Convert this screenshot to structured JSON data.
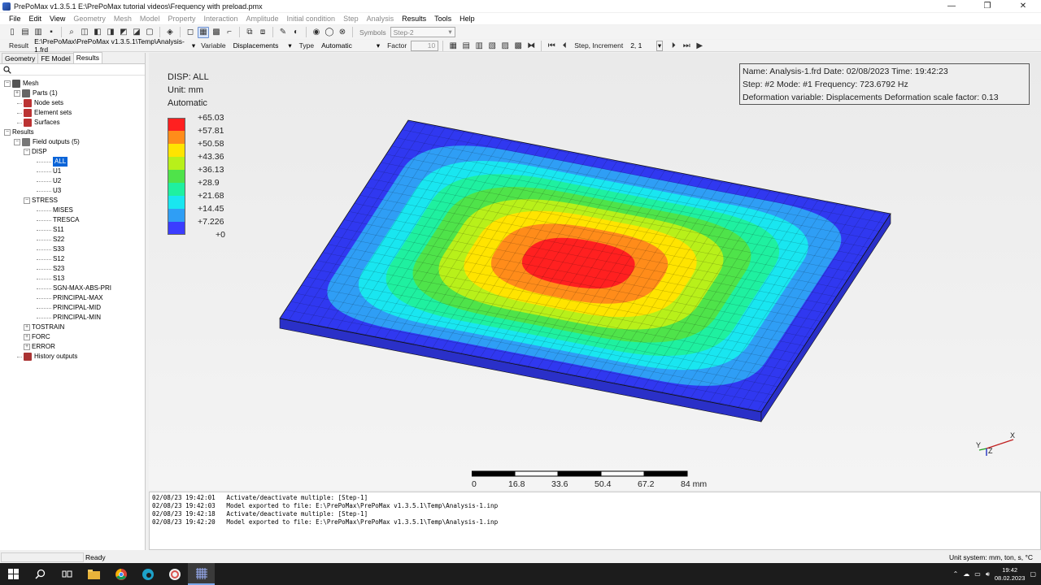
{
  "window": {
    "title": "PrePoMax v1.3.5.1   E:\\PrePoMax tutorial videos\\Frequency with preload.pmx",
    "minimize": "—",
    "maximize": "❐",
    "close": "✕"
  },
  "menu": [
    {
      "label": "File",
      "enabled": true
    },
    {
      "label": "Edit",
      "enabled": true
    },
    {
      "label": "View",
      "enabled": true
    },
    {
      "label": "Geometry",
      "enabled": false
    },
    {
      "label": "Mesh",
      "enabled": false
    },
    {
      "label": "Model",
      "enabled": false
    },
    {
      "label": "Property",
      "enabled": false
    },
    {
      "label": "Interaction",
      "enabled": false
    },
    {
      "label": "Amplitude",
      "enabled": false
    },
    {
      "label": "Initial condition",
      "enabled": false
    },
    {
      "label": "Step",
      "enabled": false
    },
    {
      "label": "Analysis",
      "enabled": false
    },
    {
      "label": "Results",
      "enabled": true
    },
    {
      "label": "Tools",
      "enabled": true
    },
    {
      "label": "Help",
      "enabled": true
    }
  ],
  "toolbar1": {
    "symbols_label": "Symbols",
    "symbols_value": "Step-2"
  },
  "toolbar2": {
    "result_label": "Result",
    "result_value": "E:\\PrePoMax\\PrePoMax v1.3.5.1\\Temp\\Analysis-1.frd",
    "variable_label": "Variable",
    "variable_value": "Displacements",
    "type_label": "Type",
    "type_value": "Automatic",
    "factor_label": "Factor",
    "factor_value": "10",
    "step_label": "Step, Increment",
    "step_value": "2, 1"
  },
  "left_panel": {
    "tabs": [
      {
        "label": "Geometry",
        "active": false
      },
      {
        "label": "FE Model",
        "active": false
      },
      {
        "label": "Results",
        "active": true
      }
    ],
    "tree": [
      {
        "label": "Mesh",
        "level": 0,
        "expander": "−",
        "icon": "mesh-icon",
        "selected": false
      },
      {
        "label": "Parts (1)",
        "level": 1,
        "expander": "+",
        "icon": "parts-icon",
        "selected": false
      },
      {
        "label": "Node sets",
        "level": 1,
        "expander": "",
        "icon": "node-sets-icon",
        "selected": false
      },
      {
        "label": "Element sets",
        "level": 1,
        "expander": "",
        "icon": "element-sets-icon",
        "selected": false
      },
      {
        "label": "Surfaces",
        "level": 1,
        "expander": "",
        "icon": "surfaces-icon",
        "selected": false
      },
      {
        "label": "Results",
        "level": 0,
        "expander": "−",
        "icon": "",
        "selected": false
      },
      {
        "label": "Field outputs (5)",
        "level": 1,
        "expander": "−",
        "icon": "field-outputs-icon",
        "selected": false
      },
      {
        "label": "DISP",
        "level": 2,
        "expander": "−",
        "icon": "",
        "selected": false
      },
      {
        "label": "ALL",
        "level": 3,
        "expander": "",
        "icon": "",
        "selected": true
      },
      {
        "label": "U1",
        "level": 3,
        "expander": "",
        "icon": "",
        "selected": false
      },
      {
        "label": "U2",
        "level": 3,
        "expander": "",
        "icon": "",
        "selected": false
      },
      {
        "label": "U3",
        "level": 3,
        "expander": "",
        "icon": "",
        "selected": false
      },
      {
        "label": "STRESS",
        "level": 2,
        "expander": "−",
        "icon": "",
        "selected": false
      },
      {
        "label": "MISES",
        "level": 3,
        "expander": "",
        "icon": "",
        "selected": false
      },
      {
        "label": "TRESCA",
        "level": 3,
        "expander": "",
        "icon": "",
        "selected": false
      },
      {
        "label": "S11",
        "level": 3,
        "expander": "",
        "icon": "",
        "selected": false
      },
      {
        "label": "S22",
        "level": 3,
        "expander": "",
        "icon": "",
        "selected": false
      },
      {
        "label": "S33",
        "level": 3,
        "expander": "",
        "icon": "",
        "selected": false
      },
      {
        "label": "S12",
        "level": 3,
        "expander": "",
        "icon": "",
        "selected": false
      },
      {
        "label": "S23",
        "level": 3,
        "expander": "",
        "icon": "",
        "selected": false
      },
      {
        "label": "S13",
        "level": 3,
        "expander": "",
        "icon": "",
        "selected": false
      },
      {
        "label": "SGN-MAX-ABS-PRI",
        "level": 3,
        "expander": "",
        "icon": "",
        "selected": false
      },
      {
        "label": "PRINCIPAL-MAX",
        "level": 3,
        "expander": "",
        "icon": "",
        "selected": false
      },
      {
        "label": "PRINCIPAL-MID",
        "level": 3,
        "expander": "",
        "icon": "",
        "selected": false
      },
      {
        "label": "PRINCIPAL-MIN",
        "level": 3,
        "expander": "",
        "icon": "",
        "selected": false
      },
      {
        "label": "TOSTRAIN",
        "level": 2,
        "expander": "+",
        "icon": "",
        "selected": false
      },
      {
        "label": "FORC",
        "level": 2,
        "expander": "+",
        "icon": "",
        "selected": false
      },
      {
        "label": "ERROR",
        "level": 2,
        "expander": "+",
        "icon": "",
        "selected": false
      },
      {
        "label": "History outputs",
        "level": 1,
        "expander": "",
        "icon": "history-outputs-icon",
        "selected": false
      }
    ]
  },
  "viewport": {
    "legend_title": "DISP: ALL",
    "legend_unit": "Unit: mm",
    "legend_type": "Automatic",
    "legend": [
      {
        "label": "+65.03",
        "color": "#ff2020"
      },
      {
        "label": "+57.81",
        "color": "#ff8c1a"
      },
      {
        "label": "+50.58",
        "color": "#ffe400"
      },
      {
        "label": "+43.36",
        "color": "#b8f01a"
      },
      {
        "label": "+36.13",
        "color": "#4fe34a"
      },
      {
        "label": "+28.9",
        "color": "#1ff0a0"
      },
      {
        "label": "+21.68",
        "color": "#19e6f0"
      },
      {
        "label": "+14.45",
        "color": "#2f9ef5"
      },
      {
        "label": "+7.226",
        "color": "#3b3dff"
      },
      {
        "label": "+0",
        "color": ""
      }
    ],
    "info": {
      "line1": "Name: Analysis-1.frd   Date: 02/08/2023   Time: 19:42:23",
      "line2": "Step: #2   Mode: #1   Frequency: 723.6792 Hz",
      "line3": "Deformation variable: Displacements   Deformation scale factor: 0.13"
    },
    "scale_bar": {
      "ticks": [
        "0",
        "16.8",
        "33.6",
        "50.4",
        "67.2",
        "84 mm"
      ]
    },
    "triad": {
      "x": "X",
      "y": "Y",
      "z": "Z"
    }
  },
  "log": [
    "02/08/23 19:42:01   Activate/deactivate multiple: [Step-1]",
    "02/08/23 19:42:03   Model exported to file: E:\\PrePoMax\\PrePoMax v1.3.5.1\\Temp\\Analysis-1.inp",
    "02/08/23 19:42:18   Activate/deactivate multiple: [Step-1]",
    "02/08/23 19:42:20   Model exported to file: E:\\PrePoMax\\PrePoMax v1.3.5.1\\Temp\\Analysis-1.inp"
  ],
  "status": {
    "ready": "Ready",
    "unit_system": "Unit system: mm, ton, s, °C"
  },
  "taskbar": {
    "time": "19:42",
    "date": "08.02.2023"
  },
  "colors": {
    "plate_border": "#3038f0",
    "plate_side": "#2a30c8",
    "selection": "#0a64d8"
  }
}
